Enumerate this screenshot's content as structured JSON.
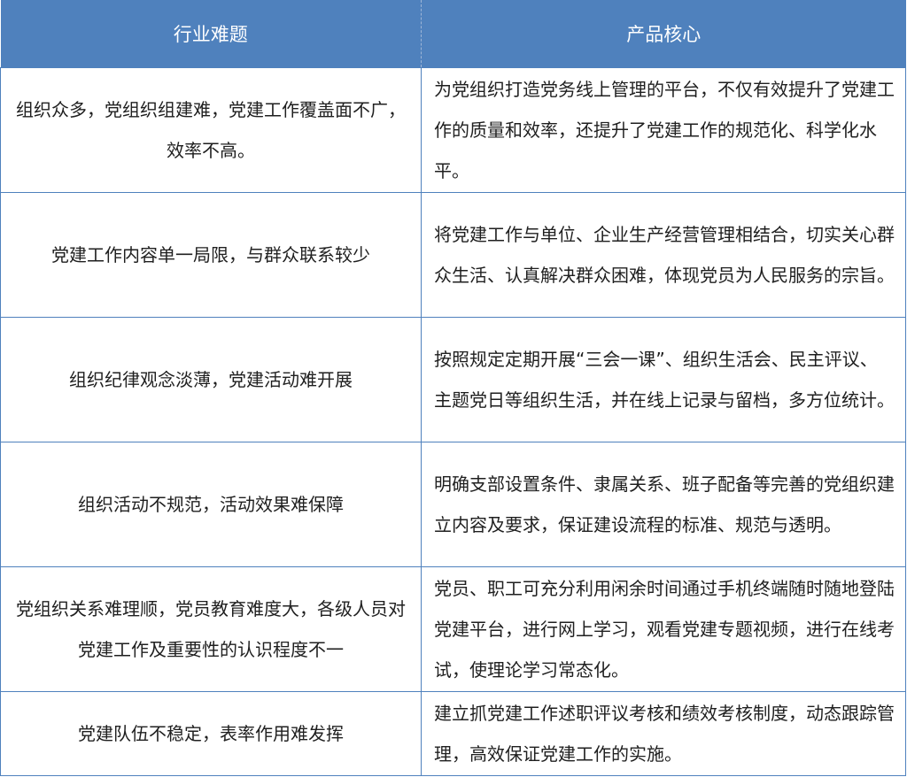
{
  "header": {
    "col1": "行业难题",
    "col2": "产品核心"
  },
  "rows": [
    {
      "problem": "组织众多，党组织组建难，党建工作覆盖面不广，效率不高。",
      "solution": "为党组织打造党务线上管理的平台，不仅有效提升了党建工作的质量和效率，还提升了党建工作的规范化、科学化水平。"
    },
    {
      "problem": "党建工作内容单一局限，与群众联系较少",
      "solution": "将党建工作与单位、企业生产经营管理相结合，切实关心群众生活、认真解决群众困难，体现党员为人民服务的宗旨。"
    },
    {
      "problem": "组织纪律观念淡薄，党建活动难开展",
      "solution": "按照规定定期开展“三会一课”、组织生活会、民主评议、主题党日等组织生活，并在线上记录与留档，多方位统计。"
    },
    {
      "problem": "组织活动不规范，活动效果难保障",
      "solution": "明确支部设置条件、隶属关系、班子配备等完善的党组织建立内容及要求，保证建设流程的标准、规范与透明。"
    },
    {
      "problem": "党组织关系难理顺，党员教育难度大，各级人员对党建工作及重要性的认识程度不一",
      "solution": "党员、职工可充分利用闲余时间通过手机终端随时随地登陆党建平台，进行网上学习，观看党建专题视频，进行在线考试，使理论学习常态化。"
    },
    {
      "problem": "党建队伍不稳定，表率作用难发挥",
      "solution": "建立抓党建工作述职评议考核和绩效考核制度，动态跟踪管理，高效保证党建工作的实施。"
    }
  ],
  "colors": {
    "header_bg": "#4f81bd",
    "header_text": "#ffffff",
    "border": "#4f81bd",
    "body_text": "#1f1f1f"
  }
}
